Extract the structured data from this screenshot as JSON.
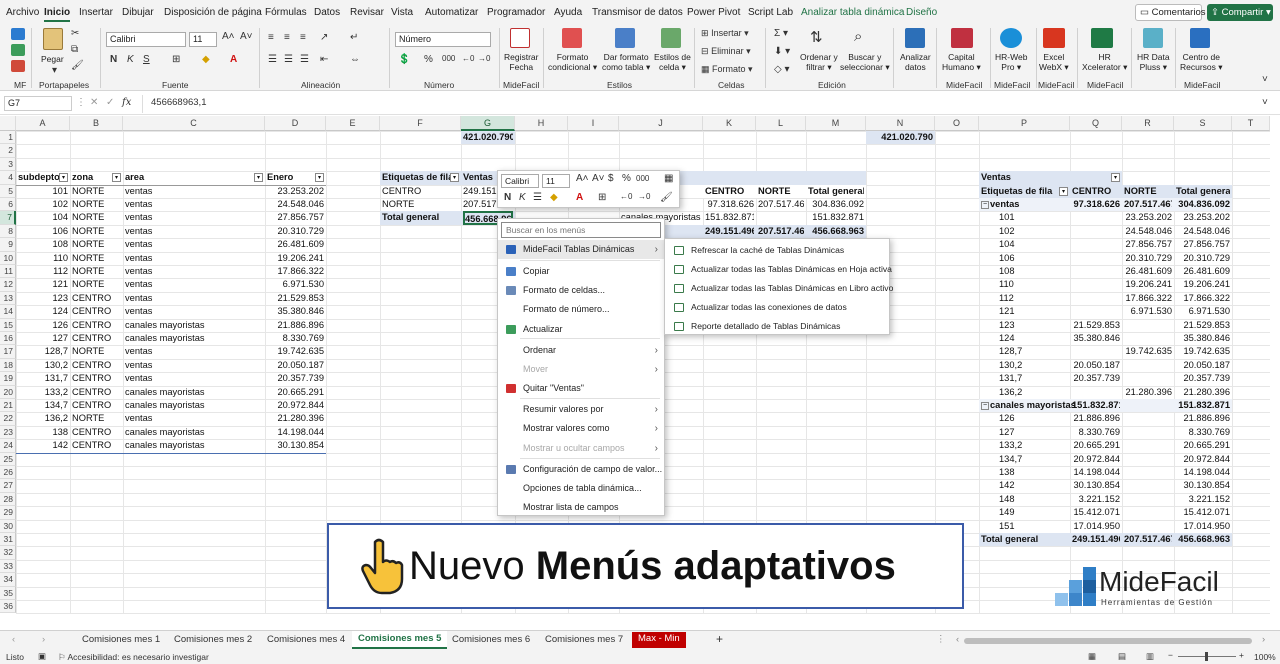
{
  "menubar": {
    "tabs": [
      "Archivo",
      "Inicio",
      "Insertar",
      "Dibujar",
      "Disposición de página",
      "Fórmulas",
      "Datos",
      "Revisar",
      "Vista",
      "Automatizar",
      "Programador",
      "Ayuda",
      "Transmisor de datos",
      "Power Pivot",
      "Script Lab",
      "Analizar tabla dinámica",
      "Diseño"
    ],
    "comentarios": "Comentarios",
    "compartir": "Compartir"
  },
  "ribbon": {
    "groups": [
      "MF",
      "Portapapeles",
      "Fuente",
      "Alineación",
      "Número",
      "MideFacil",
      "Estilos",
      "Celdas",
      "Edición",
      "MideFacil",
      "MideFacil",
      "MideFacil",
      "MideFacil",
      "MideFacil"
    ],
    "pegar": "Pegar",
    "font_name": "Calibri",
    "font_size": "11",
    "number_format": "Número",
    "registrar": [
      "Registrar",
      "Fecha"
    ],
    "formato_condicional": [
      "Formato",
      "condicional"
    ],
    "dar_formato": [
      "Dar formato",
      "como tabla"
    ],
    "estilos_celda": [
      "Estilos de",
      "celda"
    ],
    "insertar": "Insertar",
    "eliminar": "Eliminar",
    "formato": "Formato",
    "ordenar": [
      "Ordenar y",
      "filtrar"
    ],
    "buscar": [
      "Buscar y",
      "seleccionar"
    ],
    "analizar": [
      "Analizar",
      "datos"
    ],
    "capital": [
      "Capital",
      "Humano"
    ],
    "hrweb": [
      "HR-Web",
      "Pro"
    ],
    "excel_webx": [
      "Excel",
      "WebX"
    ],
    "hr_xcel": [
      "HR",
      "Xcelerator"
    ],
    "hr_data": [
      "HR Data",
      "Pluss"
    ],
    "centro": [
      "Centro de",
      "Recursos"
    ]
  },
  "formula_bar": {
    "name_box": "G7",
    "fx": "fx",
    "formula": "456668963,1"
  },
  "columns": [
    "A",
    "B",
    "C",
    "D",
    "E",
    "F",
    "G",
    "H",
    "I",
    "J",
    "K",
    "L",
    "M",
    "N",
    "O",
    "P",
    "Q",
    "R",
    "S",
    "T"
  ],
  "rows": [
    "1",
    "2",
    "3",
    "4",
    "5",
    "6",
    "7",
    "8",
    "9",
    "10",
    "11",
    "12",
    "13",
    "14",
    "15",
    "16",
    "17",
    "18",
    "19",
    "20",
    "21",
    "22",
    "23",
    "24",
    "25",
    "26",
    "27",
    "28",
    "29",
    "30",
    "31",
    "32",
    "33",
    "34",
    "35",
    "36"
  ],
  "top_values": {
    "g1": "421.020.790",
    "n1": "421.020.790"
  },
  "table_a": {
    "headers": [
      "subdepto",
      "zona",
      "area",
      "Enero"
    ],
    "rows": [
      [
        "101",
        "NORTE",
        "ventas",
        "23.253.202"
      ],
      [
        "102",
        "NORTE",
        "ventas",
        "24.548.046"
      ],
      [
        "104",
        "NORTE",
        "ventas",
        "27.856.757"
      ],
      [
        "106",
        "NORTE",
        "ventas",
        "20.310.729"
      ],
      [
        "108",
        "NORTE",
        "ventas",
        "26.481.609"
      ],
      [
        "110",
        "NORTE",
        "ventas",
        "19.206.241"
      ],
      [
        "112",
        "NORTE",
        "ventas",
        "17.866.322"
      ],
      [
        "121",
        "NORTE",
        "ventas",
        "6.971.530"
      ],
      [
        "123",
        "CENTRO",
        "ventas",
        "21.529.853"
      ],
      [
        "124",
        "CENTRO",
        "ventas",
        "35.380.846"
      ],
      [
        "126",
        "CENTRO",
        "canales mayoristas",
        "21.886.896"
      ],
      [
        "127",
        "CENTRO",
        "canales mayoristas",
        "8.330.769"
      ],
      [
        "128,7",
        "NORTE",
        "ventas",
        "19.742.635"
      ],
      [
        "130,2",
        "CENTRO",
        "ventas",
        "20.050.187"
      ],
      [
        "131,7",
        "CENTRO",
        "ventas",
        "20.357.739"
      ],
      [
        "133,2",
        "CENTRO",
        "canales mayoristas",
        "20.665.291"
      ],
      [
        "134,7",
        "CENTRO",
        "canales mayoristas",
        "20.972.844"
      ],
      [
        "136,2",
        "NORTE",
        "ventas",
        "21.280.396"
      ],
      [
        "138",
        "CENTRO",
        "canales mayoristas",
        "14.198.044"
      ],
      [
        "142",
        "CENTRO",
        "canales mayoristas",
        "30.130.854"
      ]
    ]
  },
  "pivot1": {
    "header": "Etiquetas de fila",
    "value_header": "Ventas",
    "rows": [
      [
        "CENTRO",
        "249.151."
      ],
      [
        "NORTE",
        "207.517."
      ]
    ],
    "total_label": "Total general",
    "total_value": "456.668.963"
  },
  "pivot2": {
    "frag_header": "la",
    "col_headers": [
      "CENTRO",
      "NORTE",
      "Total general"
    ],
    "row1": [
      "97.318.626",
      "207.517.467",
      "304.836.092"
    ],
    "row2_label": "canales mayoristas",
    "row2": [
      "151.832.871",
      "",
      "151.832.871"
    ],
    "total_frag": "ral",
    "total": [
      "249.151.496",
      "207.517.467",
      "456.668.963"
    ]
  },
  "pivot3": {
    "title": "Ventas",
    "row_label": "Etiquetas de fila",
    "col_headers": [
      "CENTRO",
      "NORTE",
      "Total general"
    ],
    "groups": [
      {
        "name": "ventas",
        "centro": "97.318.626",
        "norte": "207.517.467",
        "total": "304.836.092",
        "items": [
          [
            "101",
            "",
            "23.253.202",
            "23.253.202"
          ],
          [
            "102",
            "",
            "24.548.046",
            "24.548.046"
          ],
          [
            "104",
            "",
            "27.856.757",
            "27.856.757"
          ],
          [
            "106",
            "",
            "20.310.729",
            "20.310.729"
          ],
          [
            "108",
            "",
            "26.481.609",
            "26.481.609"
          ],
          [
            "110",
            "",
            "19.206.241",
            "19.206.241"
          ],
          [
            "112",
            "",
            "17.866.322",
            "17.866.322"
          ],
          [
            "121",
            "",
            "6.971.530",
            "6.971.530"
          ],
          [
            "123",
            "21.529.853",
            "",
            "21.529.853"
          ],
          [
            "124",
            "35.380.846",
            "",
            "35.380.846"
          ],
          [
            "128,7",
            "",
            "19.742.635",
            "19.742.635"
          ],
          [
            "130,2",
            "20.050.187",
            "",
            "20.050.187"
          ],
          [
            "131,7",
            "20.357.739",
            "",
            "20.357.739"
          ],
          [
            "136,2",
            "",
            "21.280.396",
            "21.280.396"
          ]
        ]
      },
      {
        "name": "canales mayoristas",
        "centro": "151.832.871",
        "norte": "",
        "total": "151.832.871",
        "items": [
          [
            "126",
            "21.886.896",
            "",
            "21.886.896"
          ],
          [
            "127",
            "8.330.769",
            "",
            "8.330.769"
          ],
          [
            "133,2",
            "20.665.291",
            "",
            "20.665.291"
          ],
          [
            "134,7",
            "20.972.844",
            "",
            "20.972.844"
          ],
          [
            "138",
            "14.198.044",
            "",
            "14.198.044"
          ],
          [
            "142",
            "30.130.854",
            "",
            "30.130.854"
          ],
          [
            "148",
            "3.221.152",
            "",
            "3.221.152"
          ],
          [
            "149",
            "15.412.071",
            "",
            "15.412.071"
          ],
          [
            "151",
            "17.014.950",
            "",
            "17.014.950"
          ]
        ]
      }
    ],
    "total_label": "Total general",
    "total": [
      "249.151.496",
      "207.517.467",
      "456.668.963"
    ]
  },
  "mini_toolbar": {
    "font": "Calibri",
    "size": "11"
  },
  "context_menu": {
    "search_placeholder": "Buscar en los menús",
    "items": [
      {
        "label": "MideFacil Tablas Dinámicas",
        "arrow": "›",
        "enabled": true
      },
      {
        "label": "Copiar",
        "enabled": true
      },
      {
        "label": "Formato de celdas...",
        "enabled": true
      },
      {
        "label": "Formato de número...",
        "enabled": true
      },
      {
        "label": "Actualizar",
        "enabled": true
      },
      {
        "label": "Ordenar",
        "arrow": "›",
        "enabled": true
      },
      {
        "label": "Mover",
        "arrow": "›",
        "enabled": false
      },
      {
        "label": "Quitar \"Ventas\"",
        "enabled": true
      },
      {
        "label": "Resumir valores por",
        "arrow": "›",
        "enabled": true
      },
      {
        "label": "Mostrar valores como",
        "arrow": "›",
        "enabled": true
      },
      {
        "label": "Mostrar u ocultar campos",
        "arrow": "›",
        "enabled": false
      },
      {
        "label": "Configuración de campo de valor...",
        "enabled": true
      },
      {
        "label": "Opciones de tabla dinámica...",
        "enabled": true
      },
      {
        "label": "Mostrar lista de campos",
        "enabled": true
      }
    ]
  },
  "submenu": {
    "items": [
      "Refrescar la caché de Tablas Dinámicas",
      "Actualizar todas las Tablas Dinámicas en Hoja activa",
      "Actualizar todas las Tablas Dinámicas en Libro activo",
      "Actualizar todas las conexiones de datos",
      "Reporte detallado de Tablas Dinámicas"
    ]
  },
  "banner": {
    "prefix": "Nuevo",
    "bold": "Menús adaptativos",
    "hand_icon": "pointing-hand-icon"
  },
  "logo": {
    "name": "MideFacil",
    "tagline": "Herramientas de Gestión"
  },
  "sheet_tabs": [
    "Comisiones mes 1",
    "Comisiones mes 2",
    "Comisiones mes 4",
    "Comisiones mes 5",
    "Comisiones mes 6",
    "Comisiones mes 7",
    "Max - Min"
  ],
  "active_sheet": "Comisiones mes 5",
  "status": {
    "mode": "Listo",
    "accessibility": "Accesibilidad: es necesario investigar",
    "zoom": "100%"
  },
  "colors": {
    "accent": "#217346",
    "pivot_header": "#dde5f2",
    "banner_border": "#3b5ba9",
    "max_min_tab": "#c00000"
  }
}
